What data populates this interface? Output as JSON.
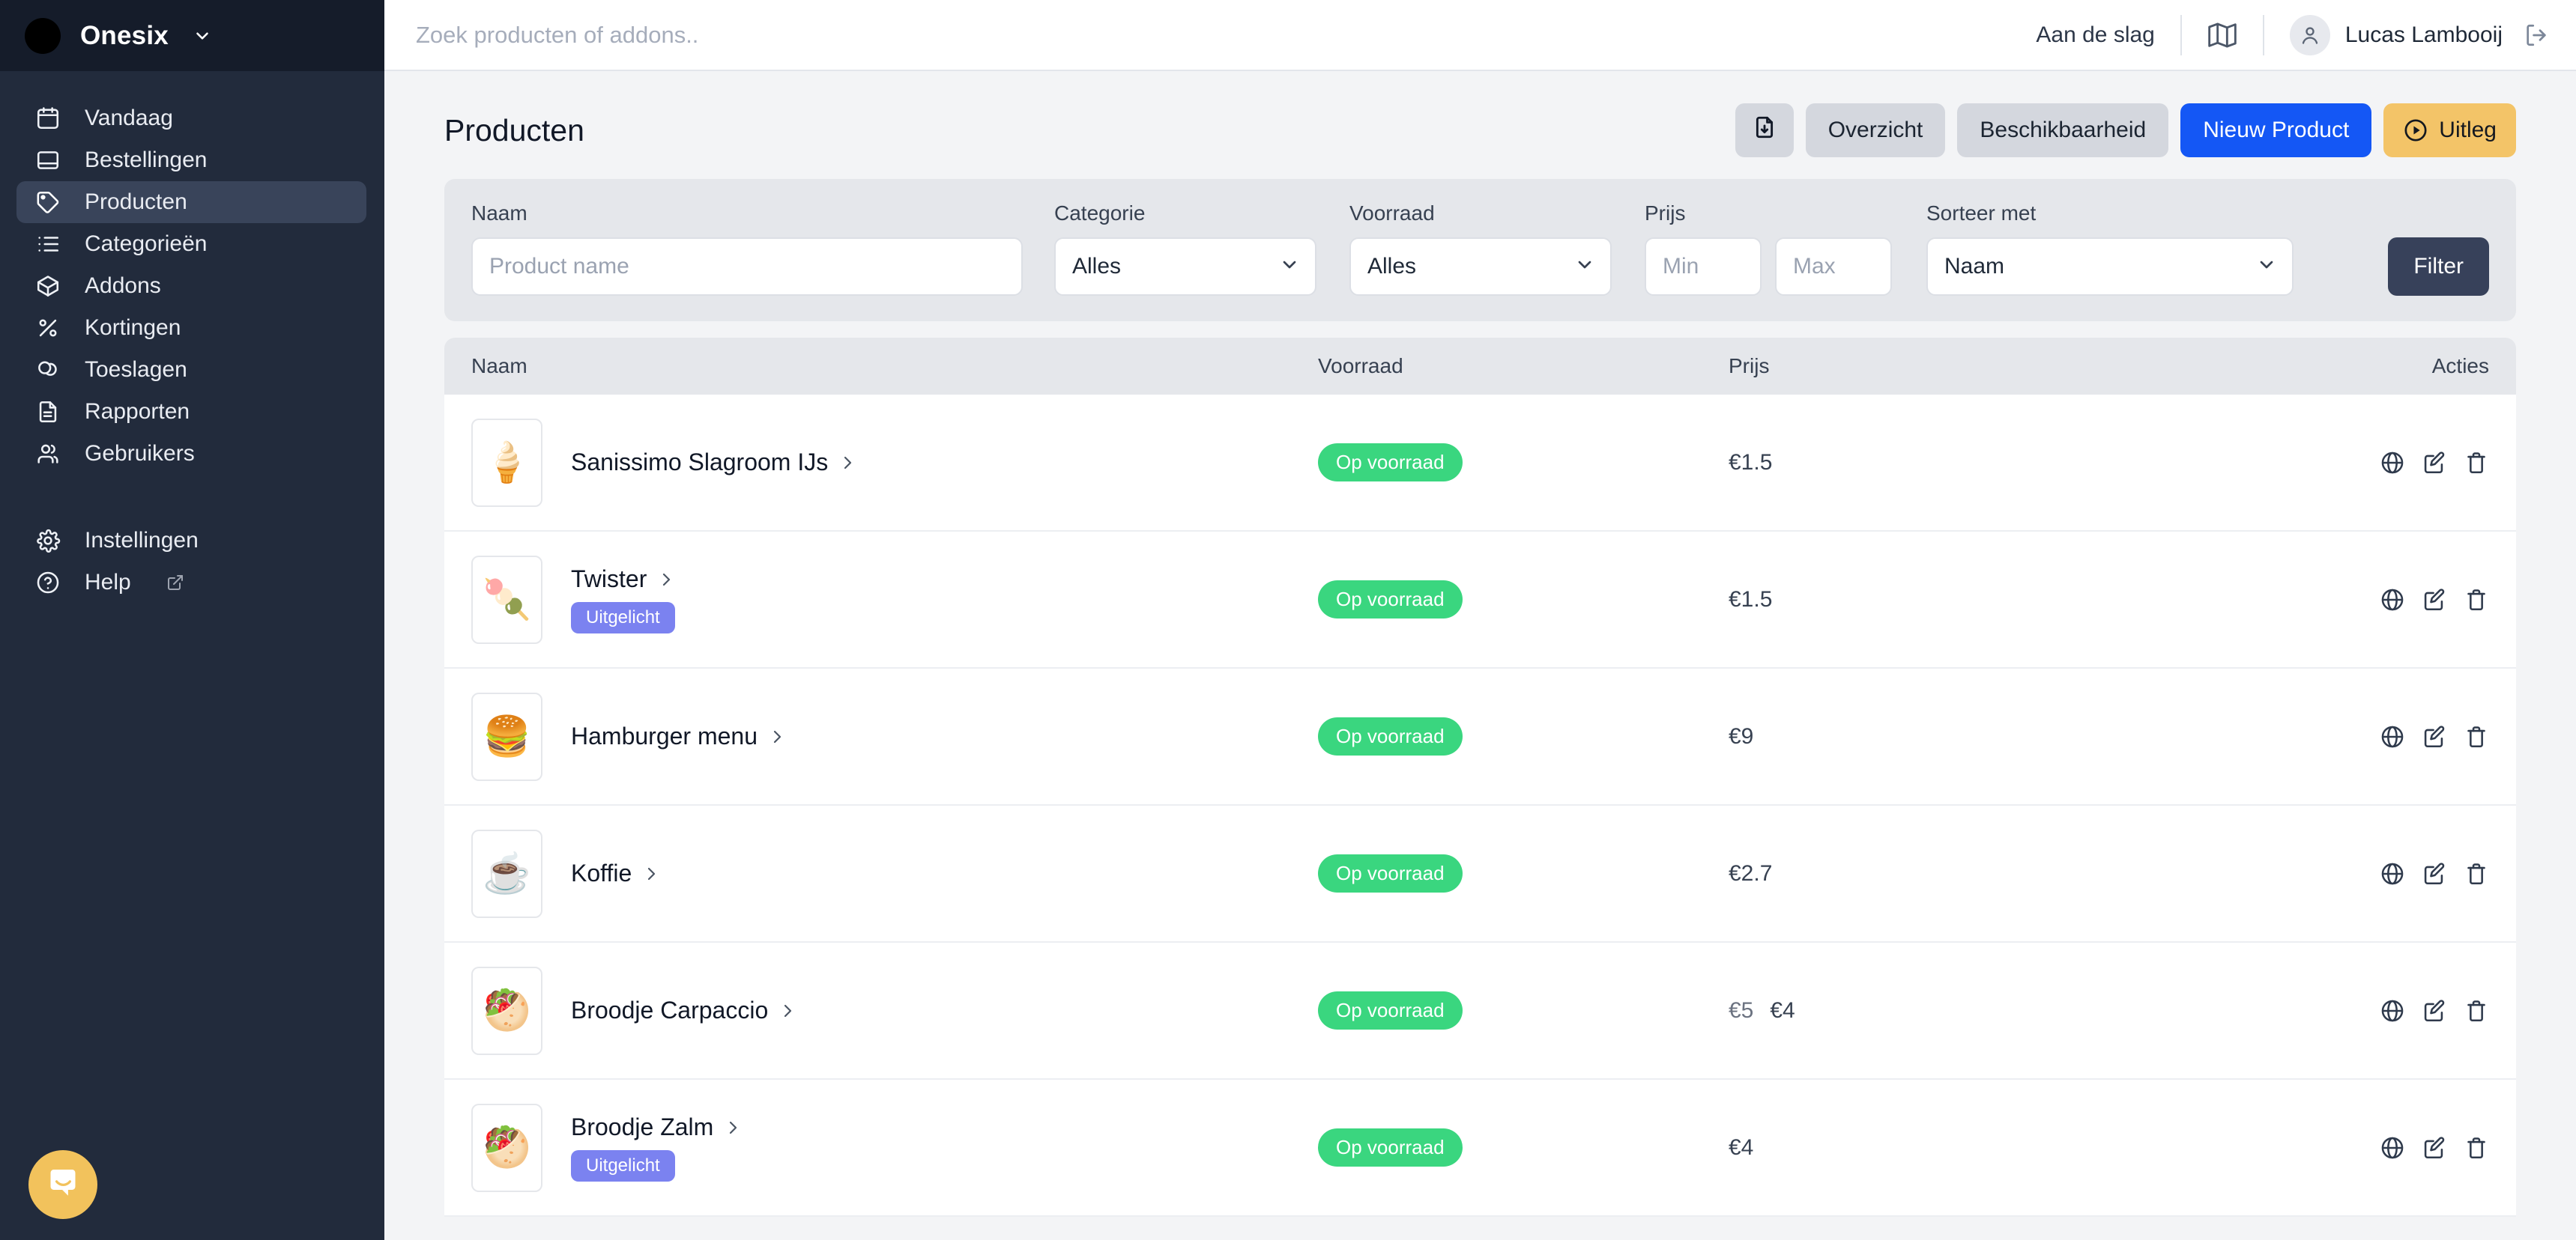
{
  "brand": {
    "name": "Onesix",
    "caret_icon": "chevron-down-icon",
    "logo_icon": "brand-logo"
  },
  "sidebar": {
    "items": [
      {
        "label": "Vandaag",
        "icon": "calendar-icon",
        "active": false
      },
      {
        "label": "Bestellingen",
        "icon": "inbox-icon",
        "active": false
      },
      {
        "label": "Producten",
        "icon": "tag-icon",
        "active": true
      },
      {
        "label": "Categorieën",
        "icon": "list-icon",
        "active": false
      },
      {
        "label": "Addons",
        "icon": "box-icon",
        "active": false
      },
      {
        "label": "Kortingen",
        "icon": "percent-icon",
        "active": false
      },
      {
        "label": "Toeslagen",
        "icon": "coins-icon",
        "active": false
      },
      {
        "label": "Rapporten",
        "icon": "document-icon",
        "active": false
      },
      {
        "label": "Gebruikers",
        "icon": "users-icon",
        "active": false
      }
    ],
    "footer_items": [
      {
        "label": "Instellingen",
        "icon": "gear-icon",
        "external": false
      },
      {
        "label": "Help",
        "icon": "question-mark-icon",
        "external": true
      }
    ],
    "chat_launcher_icon": "chat-bubble-icon",
    "chat_launcher_color": "#f2c25c"
  },
  "topbar": {
    "search_placeholder": "Zoek producten of addons..",
    "search_value": "",
    "get_started_label": "Aan de slag",
    "map_icon": "map-icon",
    "avatar_icon": "user-avatar-icon",
    "user_name": "Lucas Lambooij",
    "logout_icon": "logout-icon"
  },
  "page": {
    "title": "Producten",
    "actions": {
      "export_icon": "file-download-icon",
      "overview_label": "Overzicht",
      "availability_label": "Beschikbaarheid",
      "new_product_label": "Nieuw Product",
      "explain_label": "Uitleg",
      "explain_icon": "play-circle-icon",
      "primary_color": "#1457f5",
      "amber_color": "#f3c468"
    }
  },
  "filters": {
    "naam": {
      "label": "Naam",
      "placeholder": "Product name",
      "value": ""
    },
    "categorie": {
      "label": "Categorie",
      "value": "Alles",
      "options": [
        "Alles"
      ]
    },
    "voorraad": {
      "label": "Voorraad",
      "value": "Alles",
      "options": [
        "Alles"
      ]
    },
    "prijs": {
      "label": "Prijs",
      "min_placeholder": "Min",
      "max_placeholder": "Max",
      "min_value": "",
      "max_value": ""
    },
    "sorteer": {
      "label": "Sorteer met",
      "value": "Naam",
      "options": [
        "Naam"
      ]
    },
    "filter_button_label": "Filter"
  },
  "table": {
    "columns": {
      "naam": "Naam",
      "voorraad": "Voorraad",
      "prijs": "Prijs",
      "acties": "Acties"
    },
    "stock_badge_color": "#3ad67f",
    "featured_badge_color": "#7b82f0",
    "row_actions": [
      "globe-icon",
      "edit-icon",
      "trash-icon"
    ],
    "rows": [
      {
        "name": "Sanissimo Slagroom IJs",
        "thumb": "🍦",
        "featured": null,
        "stock": "Op voorraad",
        "price": "€1.5",
        "price_old": null
      },
      {
        "name": "Twister",
        "thumb": "🍡",
        "featured": "Uitgelicht",
        "stock": "Op voorraad",
        "price": "€1.5",
        "price_old": null
      },
      {
        "name": "Hamburger menu",
        "thumb": "🍔",
        "featured": null,
        "stock": "Op voorraad",
        "price": "€9",
        "price_old": null
      },
      {
        "name": "Koffie",
        "thumb": "☕",
        "featured": null,
        "stock": "Op voorraad",
        "price": "€2.7",
        "price_old": null
      },
      {
        "name": "Broodje Carpaccio",
        "thumb": "🥙",
        "featured": null,
        "stock": "Op voorraad",
        "price": "€4",
        "price_old": "€5"
      },
      {
        "name": "Broodje Zalm",
        "thumb": "🥙",
        "featured": "Uitgelicht",
        "stock": "Op voorraad",
        "price": "€4",
        "price_old": null
      }
    ]
  }
}
